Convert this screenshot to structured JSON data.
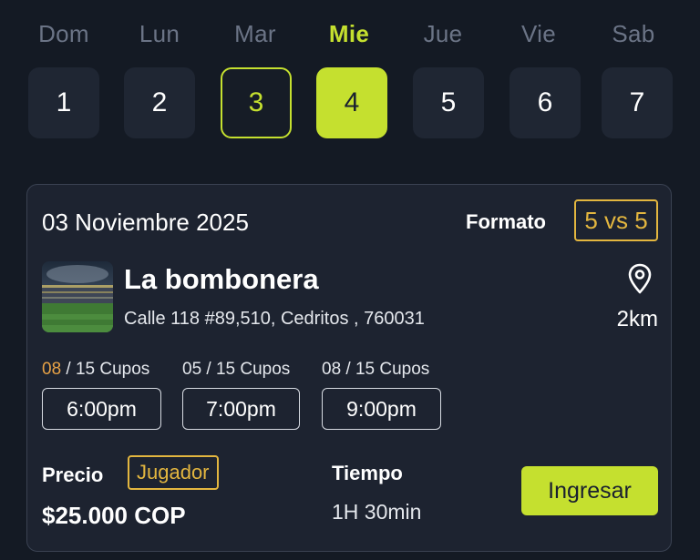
{
  "week": {
    "days": [
      {
        "name": "Dom",
        "date": "1",
        "state": "normal"
      },
      {
        "name": "Lun",
        "date": "2",
        "state": "normal"
      },
      {
        "name": "Mar",
        "date": "3",
        "state": "outlined"
      },
      {
        "name": "Mie",
        "date": "4",
        "state": "selected"
      },
      {
        "name": "Jue",
        "date": "5",
        "state": "normal"
      },
      {
        "name": "Vie",
        "date": "6",
        "state": "normal"
      },
      {
        "name": "Sab",
        "date": "7",
        "state": "normal"
      }
    ]
  },
  "card": {
    "date": "03 Noviembre 2025",
    "format_label": "Formato",
    "format_value": "5 vs 5",
    "venue_name": "La bombonera",
    "venue_address": "Calle 118 #89,510, Cedritos , 760031",
    "distance": "2km",
    "slots": [
      {
        "taken": "08",
        "rest": " / 15 Cupos",
        "time": "6:00pm",
        "taken_color": "orange"
      },
      {
        "taken": "05",
        "rest": " / 15 Cupos",
        "time": "7:00pm",
        "taken_color": "white"
      },
      {
        "taken": "08",
        "rest": " / 15 Cupos",
        "time": "9:00pm",
        "taken_color": "white"
      }
    ],
    "price_label": "Precio",
    "role": "Jugador",
    "price_value": "$25.000 COP",
    "time_label": "Tiempo",
    "time_value": "1H 30min",
    "join_label": "Ingresar"
  },
  "colors": {
    "accent": "#c5e02f",
    "badge": "#e3b63f",
    "background": "#141a24",
    "card": "#1d2330"
  },
  "icons": {
    "location": "map-pin-icon",
    "venue": "stadium-photo"
  }
}
